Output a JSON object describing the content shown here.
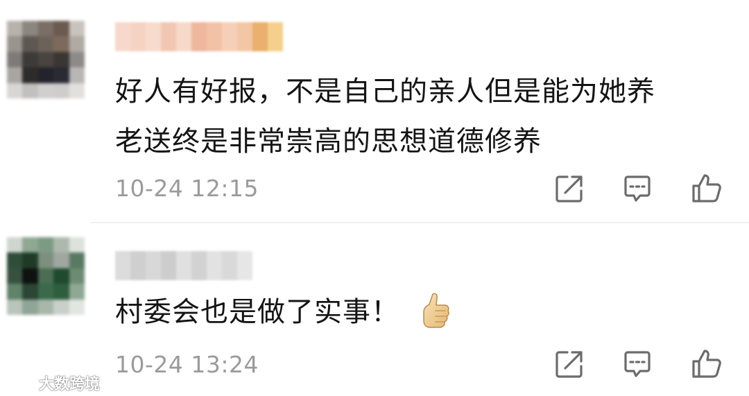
{
  "comments": [
    {
      "text_line1": "好人有好报，不是自己的亲人但是能为她养",
      "text_line2": "老送终是非常崇高的思想道德修养",
      "timestamp": "10-24 12:15",
      "avatar_colors": [
        "#b7b2ac",
        "#8c8680",
        "#7a6f67",
        "#6a5a4f",
        "#c9c3bd",
        "#9a948f",
        "#5e5853",
        "#6d625a",
        "#7d6a5c",
        "#b0aaa4",
        "#7e7a77",
        "#3d3a38",
        "#4a4440",
        "#3a3634",
        "#8e8a88",
        "#a9a5a3",
        "#2e2c2b",
        "#23232c",
        "#2a2a34",
        "#b9b6b6",
        "#d8d6d5",
        "#c2c0bf",
        "#d1cfce",
        "#cfcdcc",
        "#e2e0df"
      ],
      "name_mosaic_colors": [
        "#f6d9cc",
        "#f5d3c3",
        "#f7dccd",
        "#f2c7b2",
        "#f7d9c9",
        "#eeb79e",
        "#f3c1a6",
        "#f6cfb8",
        "#f3c7a4",
        "#ebaf6e",
        "#f4d08c"
      ]
    },
    {
      "text": "村委会也是做了实事！",
      "has_emoji": "thumbs-up",
      "timestamp": "10-24 13:24",
      "avatar_colors": [
        "#cfd6cf",
        "#8fa892",
        "#7c9a84",
        "#aeb9ae",
        "#dde2dd",
        "#2f4e3a",
        "#1f3b28",
        "#7d8f7f",
        "#a0a7a1",
        "#597a62",
        "#38513f",
        "#0f1210",
        "#4a6d54",
        "#1f4a2e",
        "#6d8b73",
        "#60836a",
        "#2b4634",
        "#3a6a4b",
        "#2e5e3e",
        "#8fa896",
        "#b9c4bb",
        "#8fa596",
        "#a8b7aa",
        "#c8d0c9",
        "#e1e6e2"
      ],
      "name_mosaic_colors": [
        "#dcdcdc",
        "#cfcfcf",
        "#d8d8d8",
        "#cdcdcd",
        "#e0e0e0",
        "#d2d2d2",
        "#e2e2e2",
        "#d9d9d9",
        "#e6e6e6"
      ]
    }
  ],
  "actions": {
    "share_icon": "share-icon",
    "reply_icon": "comment-reply-icon",
    "like_icon": "thumbs-up-icon"
  },
  "watermark": {
    "text": "大数跨境",
    "logo_icon": "weibo-logo-icon"
  },
  "colors": {
    "text": "#141414",
    "timestamp": "#9a9a9a",
    "icon": "#6b6b6b",
    "divider": "#f1f1f1"
  }
}
